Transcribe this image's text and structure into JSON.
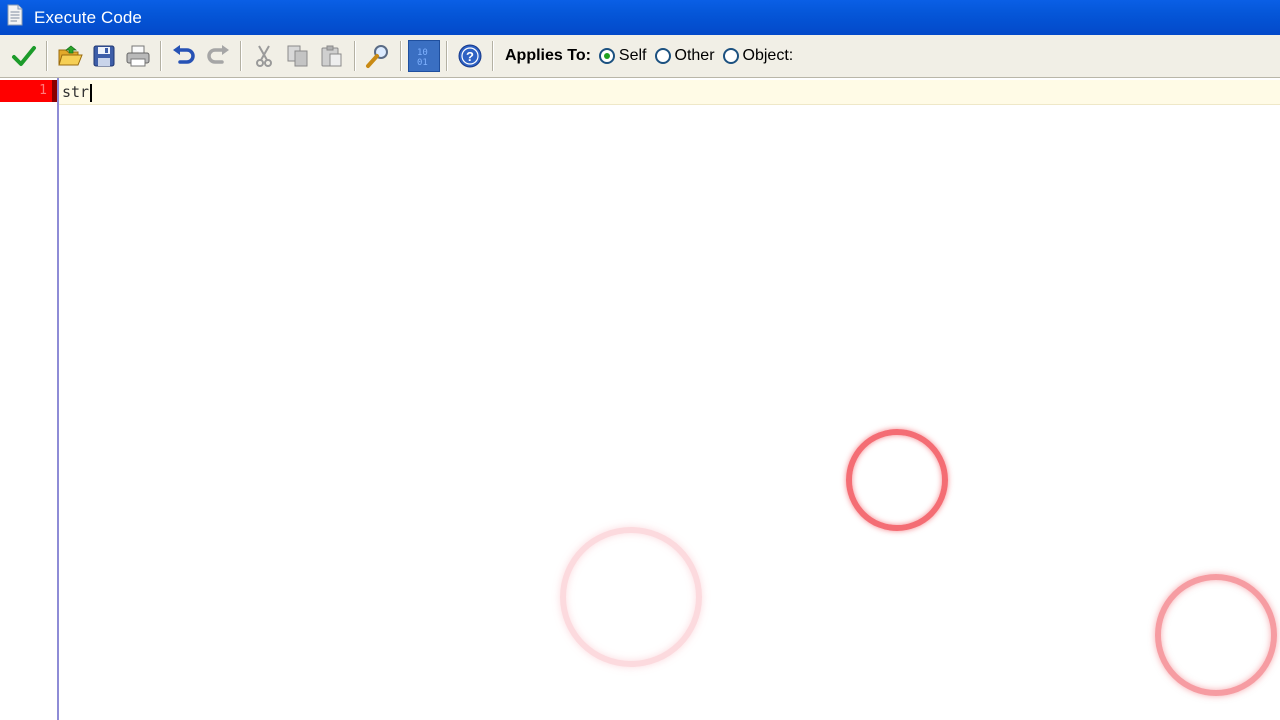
{
  "window": {
    "title": "Execute Code",
    "title_bar_color": "#0556d8"
  },
  "toolbar": {
    "buttons": [
      {
        "name": "ok",
        "icon": "checkmark-icon"
      },
      {
        "name": "open",
        "icon": "folder-open-icon"
      },
      {
        "name": "save",
        "icon": "save-icon"
      },
      {
        "name": "print",
        "icon": "print-icon"
      },
      {
        "name": "undo",
        "icon": "undo-icon"
      },
      {
        "name": "redo",
        "icon": "redo-icon"
      },
      {
        "name": "cut",
        "icon": "cut-icon"
      },
      {
        "name": "copy",
        "icon": "copy-icon"
      },
      {
        "name": "paste",
        "icon": "paste-icon"
      },
      {
        "name": "find",
        "icon": "search-icon"
      },
      {
        "name": "code-view",
        "icon": "code-view-icon",
        "pressed": true
      },
      {
        "name": "help",
        "icon": "help-icon"
      }
    ],
    "applies_to_label": "Applies To:",
    "radio_options": [
      {
        "label": "Self",
        "checked": true
      },
      {
        "label": "Other",
        "checked": false
      },
      {
        "label": "Object:",
        "checked": false
      }
    ]
  },
  "editor": {
    "lines": [
      {
        "number": "1",
        "text": "str"
      }
    ],
    "line_marker_color": "#ff0000",
    "current_line_color": "#fffbe6"
  },
  "click_indicators": {
    "color": "#f03c46",
    "count": 3
  }
}
